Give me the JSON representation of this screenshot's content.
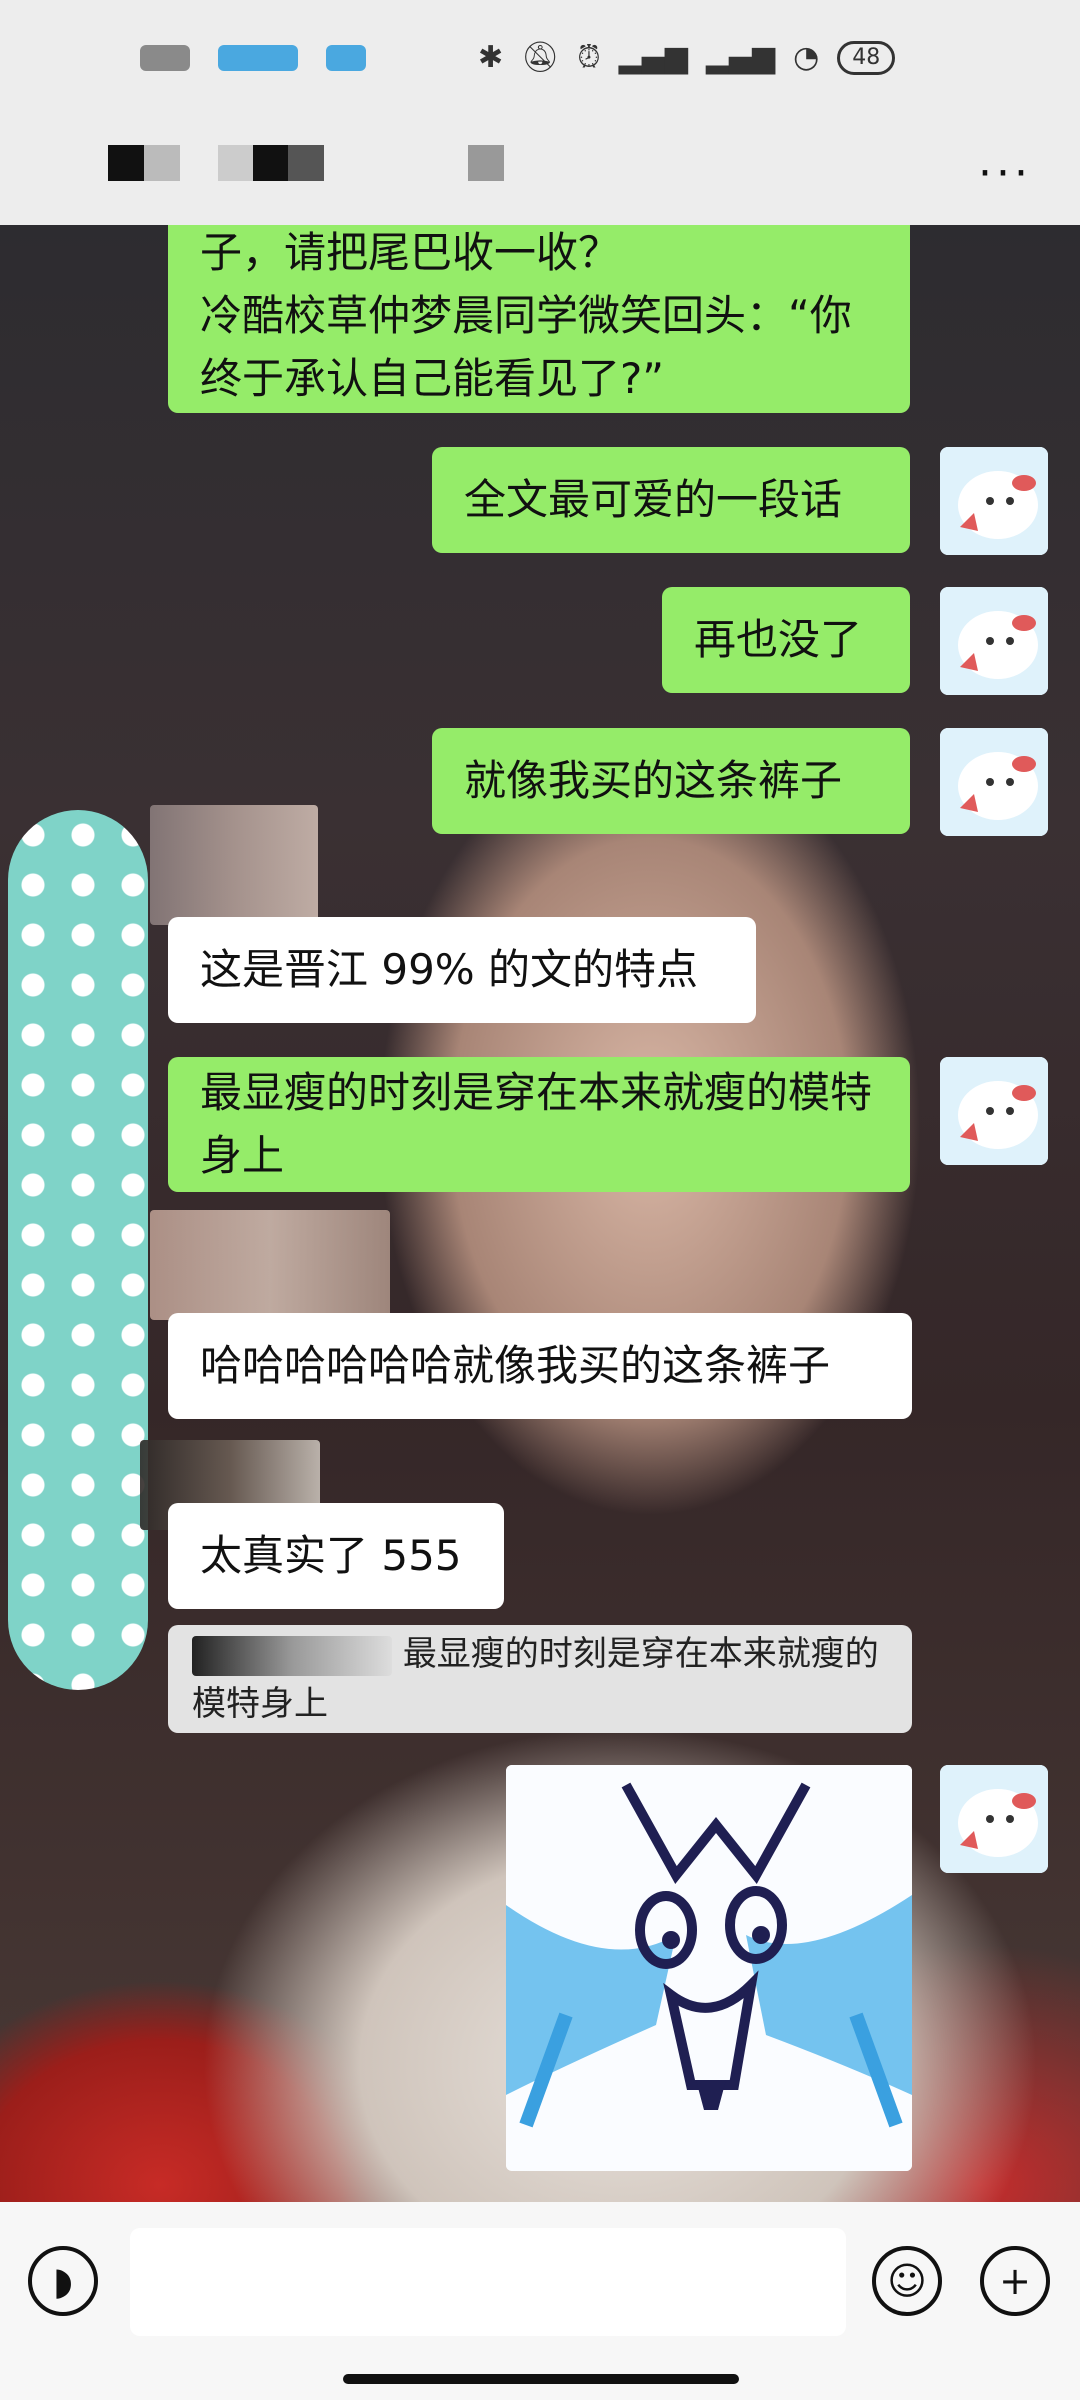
{
  "status_bar": {
    "battery": "48",
    "icons": [
      "bluetooth-icon",
      "mute-icon",
      "alarm-icon",
      "signal-icon",
      "signal-icon",
      "wifi-icon"
    ]
  },
  "header": {
    "more_label": "···"
  },
  "messages": [
    {
      "side": "right",
      "type": "text",
      "text": "子，请把尾巴收一收？\n冷酷校草仲梦晨同学微笑回头：“你终于承认自己能看见了?”"
    },
    {
      "side": "right",
      "type": "text",
      "text": "全文最可爱的一段话"
    },
    {
      "side": "right",
      "type": "text",
      "text": "再也没了"
    },
    {
      "side": "right",
      "type": "text",
      "text": "就像我买的这条裤子"
    },
    {
      "side": "left",
      "type": "text",
      "text": "这是晋江 99% 的文的特点"
    },
    {
      "side": "right",
      "type": "text",
      "text": "最显瘦的时刻是穿在本来就瘦的模特身上"
    },
    {
      "side": "left",
      "type": "text",
      "text": "哈哈哈哈哈哈就像我买的这条裤子"
    },
    {
      "side": "left",
      "type": "text",
      "text": "太真实了 555"
    },
    {
      "side": "left",
      "type": "quote",
      "text": "最显瘦的时刻是穿在本来就瘦的模特身上"
    },
    {
      "side": "right",
      "type": "sticker",
      "icon": "crying-face-sticker"
    }
  ],
  "input_bar": {
    "voice_icon": "voice-icon",
    "emoji_icon": "emoji-icon",
    "plus_icon": "plus-icon"
  },
  "colors": {
    "my_bubble": "#95ec69",
    "their_bubble": "#ffffff",
    "bar_bg": "#ededed"
  }
}
